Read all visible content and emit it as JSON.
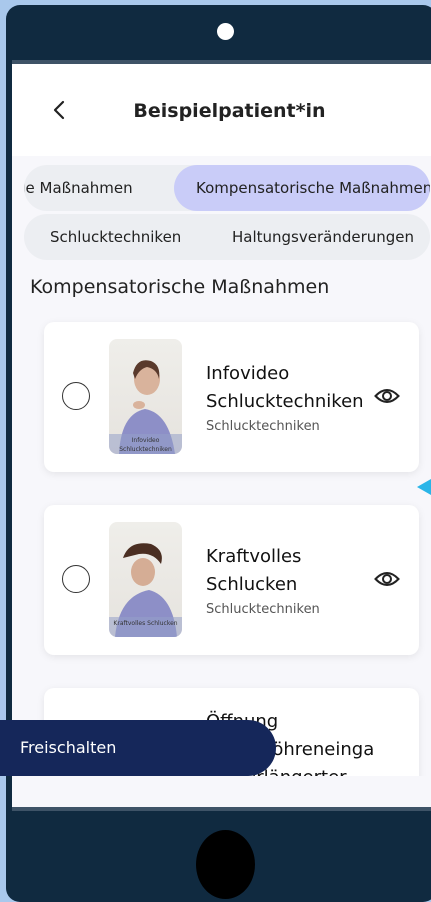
{
  "header": {
    "title": "Beispielpatient*in"
  },
  "filters_row1": [
    {
      "label": "Vorbereitende Maßnahmen",
      "visible_label": "de Maßnahmen",
      "active": false
    },
    {
      "label": "Kompensatorische Maßnahmen",
      "visible_label": "Kompensatorische Maßnahmen",
      "active": true
    }
  ],
  "filters_row2": [
    {
      "label": "Schlucktechniken",
      "active": false
    },
    {
      "label": "Haltungsveränderungen",
      "active": false
    }
  ],
  "section_title": "Kompensatorische Maßnahmen",
  "cards": [
    {
      "title_line1": "Infovideo",
      "title_line2": "Schlucktechniken",
      "subtitle": "Schlucktechniken",
      "thumb_caption": "Infovideo Schlucktechniken",
      "selected": false
    },
    {
      "title_line1": "Kraftvolles",
      "title_line2": "Schlucken",
      "subtitle": "Schlucktechniken",
      "thumb_caption": "Kraftvolles Schlucken",
      "selected": false
    },
    {
      "title_line1": "Öffnung",
      "title_line2": "Speiseröhreneinga",
      "title_line3": "ng verlängerter",
      "subtitle": "",
      "thumb_caption": "",
      "selected": false
    }
  ],
  "action_button": {
    "label": "Freischalten"
  },
  "colors": {
    "device_frame": "#102a40",
    "active_tab": "#c9ccf8",
    "action_button": "#15275a",
    "accent_arrow": "#2ab5e8"
  },
  "icons": {
    "back": "chevron-left-icon",
    "preview": "eye-icon",
    "select": "radio-circle-icon"
  }
}
